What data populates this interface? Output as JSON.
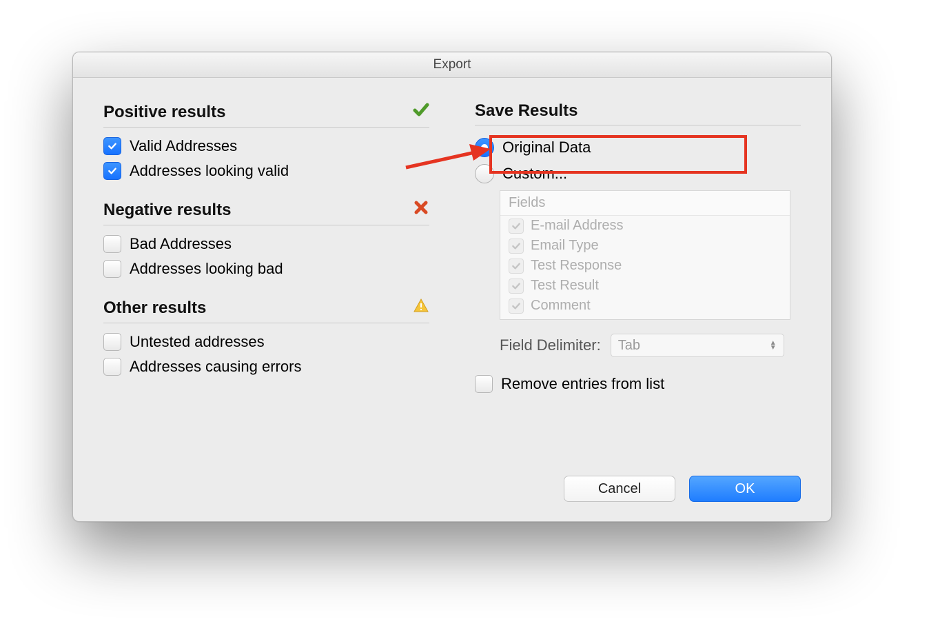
{
  "window": {
    "title": "Export"
  },
  "left": {
    "positive": {
      "heading": "Positive results",
      "valid_addresses": {
        "label": "Valid Addresses",
        "checked": true
      },
      "addresses_looking_valid": {
        "label": "Addresses looking valid",
        "checked": true
      }
    },
    "negative": {
      "heading": "Negative results",
      "bad_addresses": {
        "label": "Bad Addresses",
        "checked": false
      },
      "addresses_looking_bad": {
        "label": "Addresses looking bad",
        "checked": false
      }
    },
    "other": {
      "heading": "Other results",
      "untested_addresses": {
        "label": "Untested addresses",
        "checked": false
      },
      "addresses_causing_errors": {
        "label": "Addresses causing errors",
        "checked": false
      }
    }
  },
  "right": {
    "heading": "Save Results",
    "original_data": {
      "label": "Original Data",
      "selected": true
    },
    "custom": {
      "label": "Custom...",
      "selected": false
    },
    "fields_header": "Fields",
    "fields": [
      {
        "label": "E-mail Address"
      },
      {
        "label": "Email Type"
      },
      {
        "label": "Test Response"
      },
      {
        "label": "Test Result"
      },
      {
        "label": "Comment"
      }
    ],
    "field_delimiter_label": "Field Delimiter:",
    "field_delimiter_value": "Tab",
    "remove_entries": {
      "label": "Remove entries from list",
      "checked": false
    }
  },
  "buttons": {
    "cancel": "Cancel",
    "ok": "OK"
  }
}
